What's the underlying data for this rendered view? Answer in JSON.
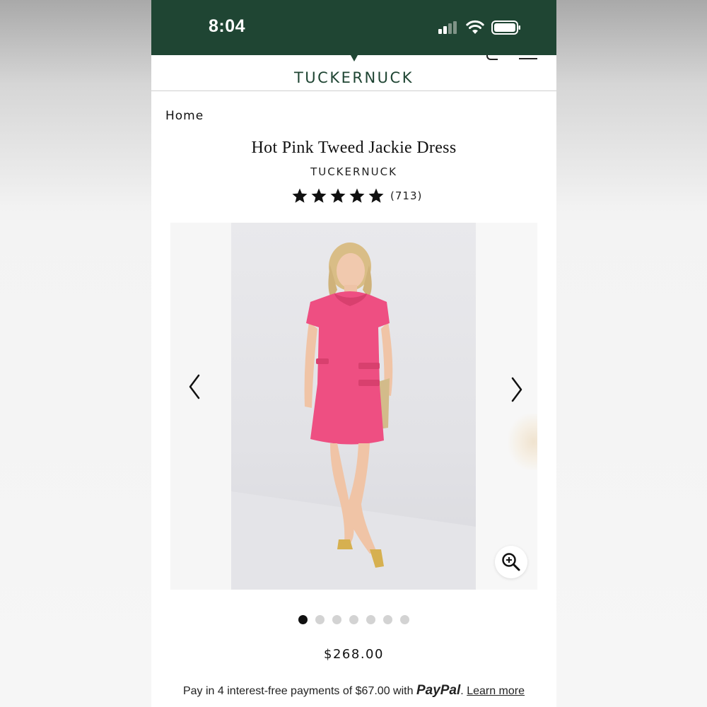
{
  "status_bar": {
    "time": "8:04"
  },
  "header": {
    "brand_logo": "TUCKERNUCK"
  },
  "breadcrumb": {
    "home": "Home"
  },
  "product": {
    "title": "Hot Pink Tweed Jackie Dress",
    "brand": "TUCKERNUCK",
    "rating": 5,
    "review_count": "(713)",
    "price": "$268.00",
    "dress_color": "#ee4f82"
  },
  "carousel": {
    "image_count": 7,
    "active_index": 0
  },
  "paypal": {
    "text": "Pay in 4 interest-free payments of $67.00 with",
    "logo": "PayPal",
    "learn_more": "Learn more"
  },
  "colors": {
    "brand_green": "#1f4533"
  }
}
